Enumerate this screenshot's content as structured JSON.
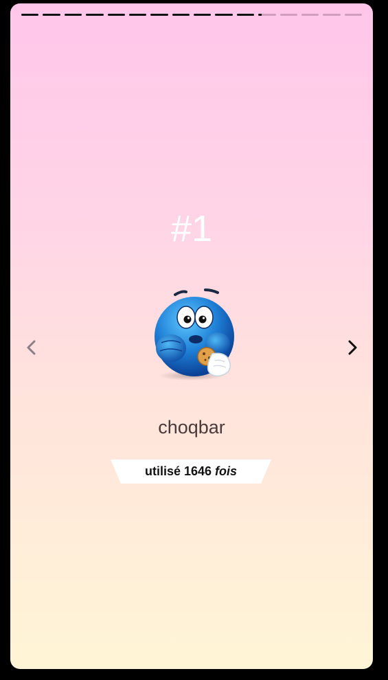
{
  "story": {
    "segments_total": 16,
    "segments_complete": 11,
    "current_segment_fraction": 0.2
  },
  "rank_label": "#1",
  "emoji": {
    "icon": "blue-smiley-eating-cookie-icon"
  },
  "item": {
    "name": "choqbar",
    "usage_prefix": "utilisé",
    "usage_count": "1646",
    "usage_suffix": "fois"
  },
  "nav": {
    "prev_icon": "chevron-left-icon",
    "next_icon": "chevron-right-icon"
  },
  "colors": {
    "gradient_top": "#ffc6ea",
    "gradient_bottom": "#fff5d6",
    "progress_done": "#111111",
    "progress_pending": "#b98aa8",
    "rank_text": "#ffffff",
    "name_text": "#4a3a3a",
    "badge_bg": "#ffffff"
  }
}
